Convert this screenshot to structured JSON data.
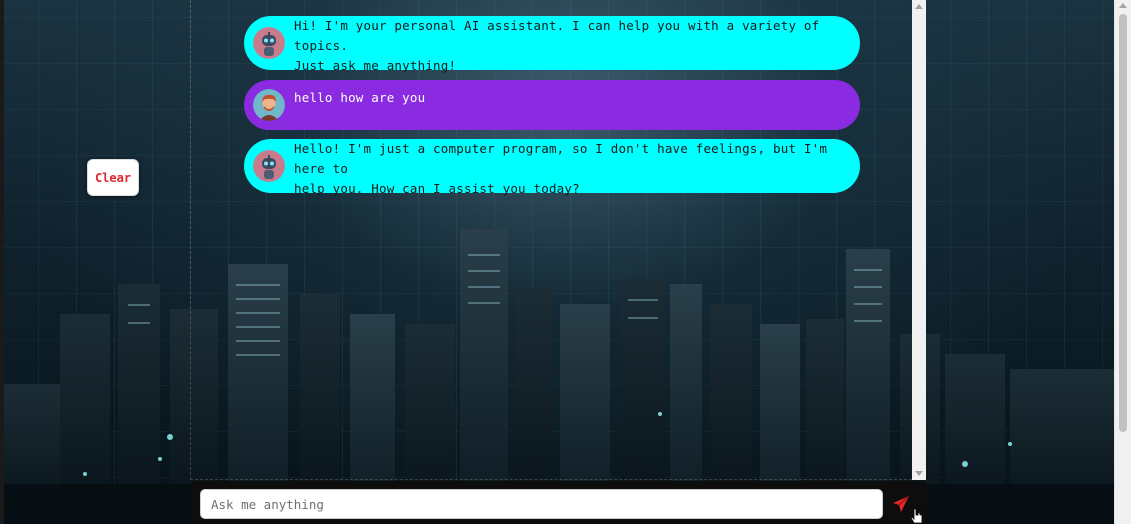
{
  "chat": {
    "messages": [
      {
        "role": "bot",
        "avatar": "robot-avatar",
        "text": "Hi! I'm your personal AI assistant. I can help you with a variety of topics.\nJust ask me anything!"
      },
      {
        "role": "user",
        "avatar": "user-avatar",
        "text": "hello how are you"
      },
      {
        "role": "bot",
        "avatar": "robot-avatar",
        "text": "Hello! I'm just a computer program, so I don't have feelings, but I'm here to\nhelp you. How can I assist you today?"
      }
    ]
  },
  "controls": {
    "clear_label": "Clear",
    "input_placeholder": "Ask me anything",
    "send_icon": "paper-plane-icon"
  },
  "colors": {
    "bot_bubble": "#00ffff",
    "user_bubble": "#8a2be2",
    "clear_text": "#e3262a",
    "send_icon": "#e3262a"
  }
}
